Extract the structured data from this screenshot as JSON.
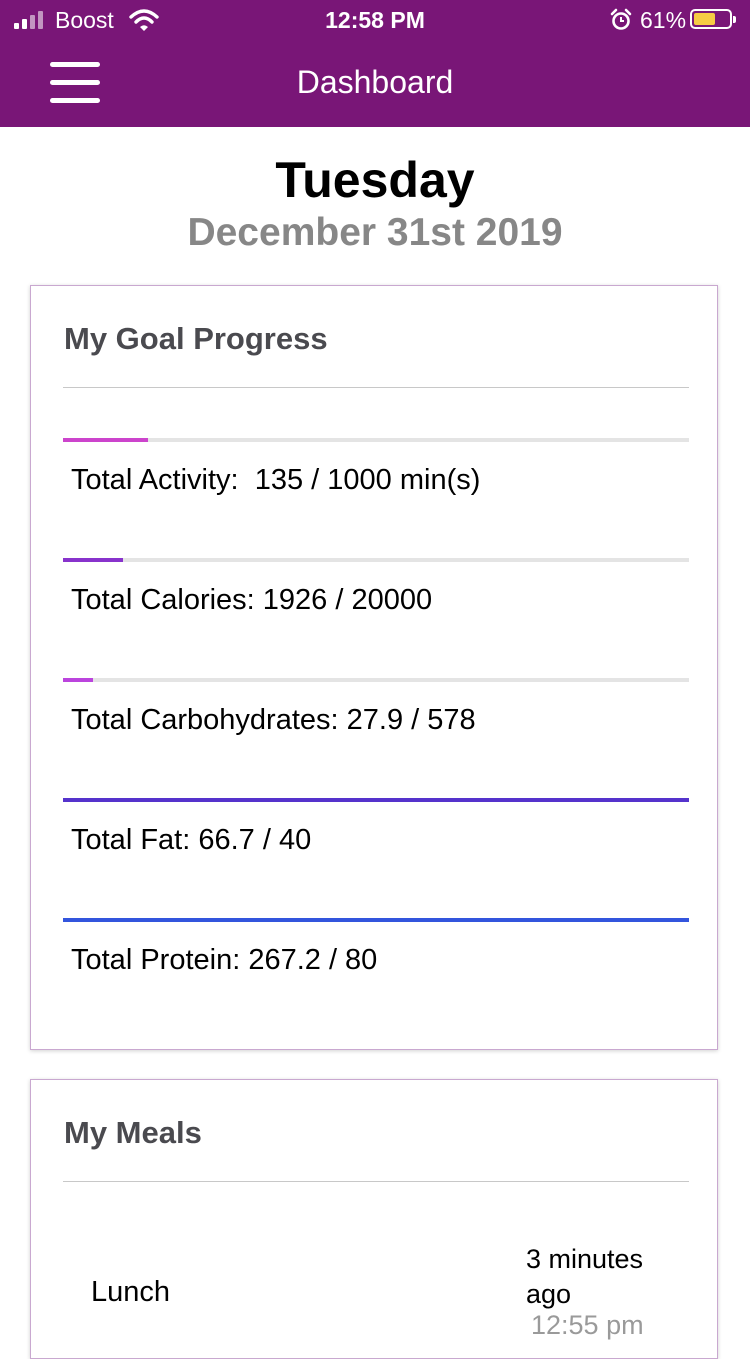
{
  "status_bar": {
    "carrier": "Boost",
    "time": "12:58 PM",
    "battery_percent": "61%",
    "battery_level": 0.61,
    "icons": [
      "signal-icon",
      "wifi-icon",
      "alarm-icon",
      "battery-icon"
    ]
  },
  "header": {
    "title": "Dashboard",
    "menu_icon": "hamburger-menu-icon",
    "background_color": "#791677"
  },
  "date_header": {
    "day": "Tuesday",
    "date": "December 31st 2019"
  },
  "goal_card": {
    "title": "My Goal Progress",
    "goals": [
      {
        "label": "Total Activity:  135 / 1000 min(s)",
        "progress": 0.135,
        "color": "#cc44cc"
      },
      {
        "label": "Total Calories: 1926 / 20000",
        "progress": 0.0963,
        "color": "#8833cc"
      },
      {
        "label": "Total Carbohydrates: 27.9 / 578",
        "progress": 0.048,
        "color": "#bb44dd"
      },
      {
        "label": "Total Fat: 66.7 / 40",
        "progress": 1.0,
        "color": "#5533cc"
      },
      {
        "label": "Total Protein: 267.2 / 80",
        "progress": 1.0,
        "color": "#3355dd"
      }
    ]
  },
  "meals_card": {
    "title": "My Meals",
    "meals": [
      {
        "name": "Lunch",
        "ago": "3 minutes ago",
        "time": "12:55 pm"
      }
    ]
  }
}
